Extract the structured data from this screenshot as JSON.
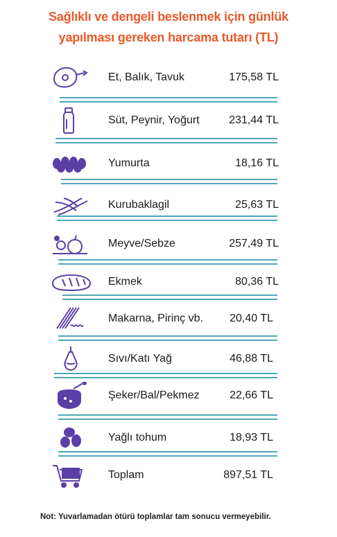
{
  "title_line1": "Sağlıklı ve dengeli beslenmek için günlük",
  "title_line2": "yapılması gereken harcama tutarı (TL)",
  "rows": [
    {
      "icon": "meat-icon",
      "label": "Et, Balık, Tavuk",
      "value": "175,58 TL"
    },
    {
      "icon": "milk-bottle-icon",
      "label": "Süt, Peynir, Yoğurt",
      "value": "231,44 TL"
    },
    {
      "icon": "eggs-icon",
      "label": "Yumurta",
      "value": "18,16 TL"
    },
    {
      "icon": "legumes-icon",
      "label": "Kurubaklagil",
      "value": "25,63 TL"
    },
    {
      "icon": "fruit-bowl-icon",
      "label": "Meyve/Sebze",
      "value": "257,49 TL"
    },
    {
      "icon": "bread-icon",
      "label": "Ekmek",
      "value": "80,36 TL"
    },
    {
      "icon": "pasta-icon",
      "label": "Makarna, Pirinç vb.",
      "value": "20,40 TL"
    },
    {
      "icon": "oil-bottle-icon",
      "label": "Sıvı/Katı Yağ",
      "value": "46,88 TL"
    },
    {
      "icon": "honey-pot-icon",
      "label": "Şeker/Bal/Pekmez",
      "value": "22,66 TL"
    },
    {
      "icon": "nuts-icon",
      "label": "Yağlı tohum",
      "value": "18,93 TL"
    },
    {
      "icon": "shopping-cart-icon",
      "label": "Toplam",
      "value": "897,51 TL"
    }
  ],
  "note": "Not: Yuvarlamadan ötürü toplamlar tam sonucu vermeyebilir.",
  "colors": {
    "title": "#e85a2a",
    "icon": "#5b3fa6",
    "rule": "#4fa8b8"
  }
}
